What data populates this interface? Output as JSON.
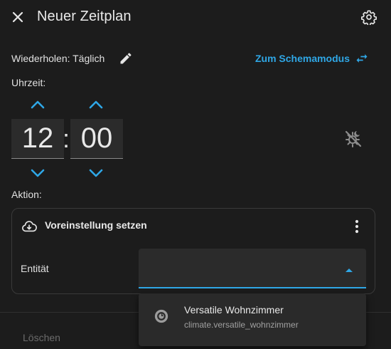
{
  "header": {
    "title": "Neuer Zeitplan",
    "close_icon": "close-icon",
    "settings_icon": "gear-icon"
  },
  "repeat": {
    "label": "Wiederholen: Täglich",
    "edit_icon": "pencil-icon"
  },
  "mode_switch": {
    "label": "Zum Schemamodus",
    "icon": "swap-horizontal-icon"
  },
  "time": {
    "label": "Uhrzeit:",
    "hours": "12",
    "separator": ":",
    "minutes": "00",
    "sun_icon": "sun-moon-off-icon"
  },
  "action": {
    "label": "Aktion:",
    "card_title": "Voreinstellung setzen",
    "card_icon": "cloud-download-icon",
    "menu_icon": "dots-vertical-icon",
    "entity_label": "Entität",
    "entity_value": ""
  },
  "dropdown": {
    "options": [
      {
        "name": "Versatile Wohnzimmer",
        "id": "climate.versatile_wohnzimmer",
        "icon": "thermostat-icon"
      }
    ]
  },
  "footer": {
    "delete_label": "Löschen"
  },
  "colors": {
    "background": "#1c1c1c",
    "accent": "#2fa7e6",
    "field": "#2b2b2b",
    "text": "#e1e1e1",
    "muted": "#6b6b6b"
  }
}
